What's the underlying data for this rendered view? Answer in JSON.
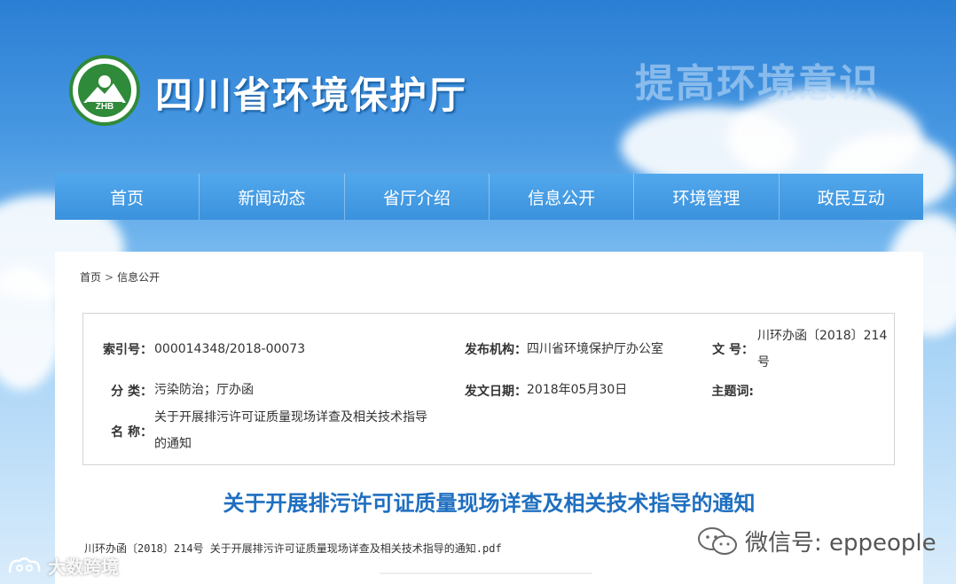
{
  "header": {
    "site_title": "四川省环境保护厅",
    "logo_text": "ZHB",
    "slogan": "提高环境意识"
  },
  "nav": {
    "items": [
      "首页",
      "新闻动态",
      "省厅介绍",
      "信息公开",
      "环境管理",
      "政民互动"
    ]
  },
  "breadcrumb": {
    "home": "首页",
    "separator": ">",
    "current": "信息公开"
  },
  "info": {
    "index_label": "索引号：",
    "index_value": "000014348/2018-00073",
    "org_label": "发布机构：",
    "org_value": "四川省环境保护厅办公室",
    "docno_label": "文 号：",
    "docno_value_1": "川环办函〔2018〕214",
    "docno_value_2": "号",
    "category_label": "分 类：",
    "category_value": "污染防治；厅办函",
    "date_label": "发文日期：",
    "date_value": "2018年05月30日",
    "subject_label": "主题词:",
    "name_label": "名 称：",
    "name_value_1": "关于开展排污许可证质量现场详查及相关技术指导",
    "name_value_2": "的通知"
  },
  "document": {
    "title": "关于开展排污许可证质量现场详查及相关技术指导的通知",
    "attachment": "川环办函〔2018〕214号 关于开展排污许可证质量现场详查及相关技术指导的通知.pdf"
  },
  "watermarks": {
    "wechat": "微信号: eppeople",
    "dsj": "大数跨境"
  },
  "colors": {
    "nav_bg": "#3b92dd",
    "title_blue": "#1f6fc0",
    "logo_green": "#2f8a3a"
  }
}
